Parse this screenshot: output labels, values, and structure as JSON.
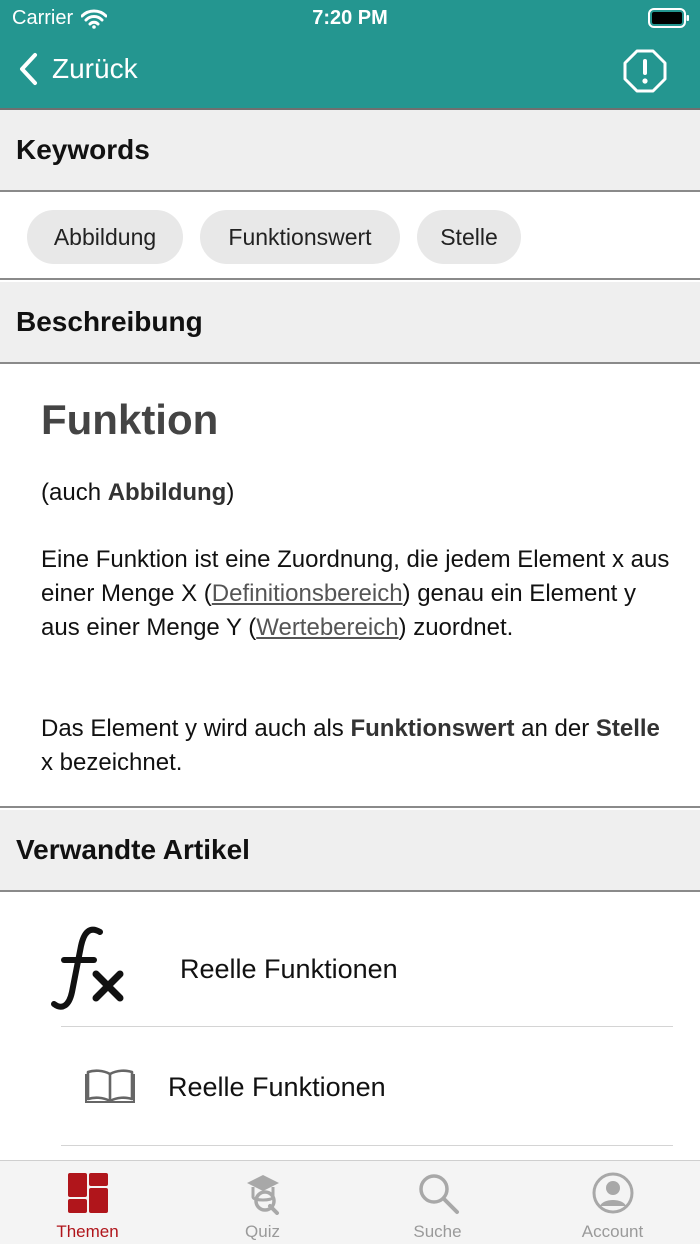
{
  "status_bar": {
    "carrier": "Carrier",
    "time": "7:20 PM"
  },
  "nav": {
    "back_label": "Zurück",
    "accent_color": "#249690"
  },
  "sections": {
    "keywords": "Keywords",
    "description": "Beschreibung",
    "related": "Verwandte Artikel"
  },
  "keywords": [
    "Abbildung",
    "Funktionswert",
    "Stelle"
  ],
  "article": {
    "title": "Funktion",
    "p1_pre": "(auch ",
    "p1_bold": "Abbildung",
    "p1_post": ")",
    "p2_a": "Eine Funktion ist eine Zuordnung, die jedem Element x aus einer Menge X (",
    "p2_link1": "Definitionsbereich",
    "p2_b": ") genau ein Element y aus einer Menge Y (",
    "p2_link2": "Wertebereich",
    "p2_c": ") zuordnet.",
    "p3_a": "Das Element y wird auch als ",
    "p3_bold1": "Funktionswert",
    "p3_b": " an der ",
    "p3_bold2": "Stelle",
    "p3_c": " x bezeichnet."
  },
  "related_items": [
    {
      "label": "Reelle Funktionen",
      "icon": "function-fx-icon"
    },
    {
      "label": "Reelle Funktionen",
      "icon": "book-icon"
    }
  ],
  "tabs": [
    {
      "label": "Themen",
      "icon": "grid-icon",
      "active": true
    },
    {
      "label": "Quiz",
      "icon": "quiz-icon",
      "active": false
    },
    {
      "label": "Suche",
      "icon": "search-icon",
      "active": false
    },
    {
      "label": "Account",
      "icon": "account-icon",
      "active": false
    }
  ],
  "colors": {
    "active_tab": "#b0151b",
    "inactive_tab": "#9a9a9a"
  }
}
